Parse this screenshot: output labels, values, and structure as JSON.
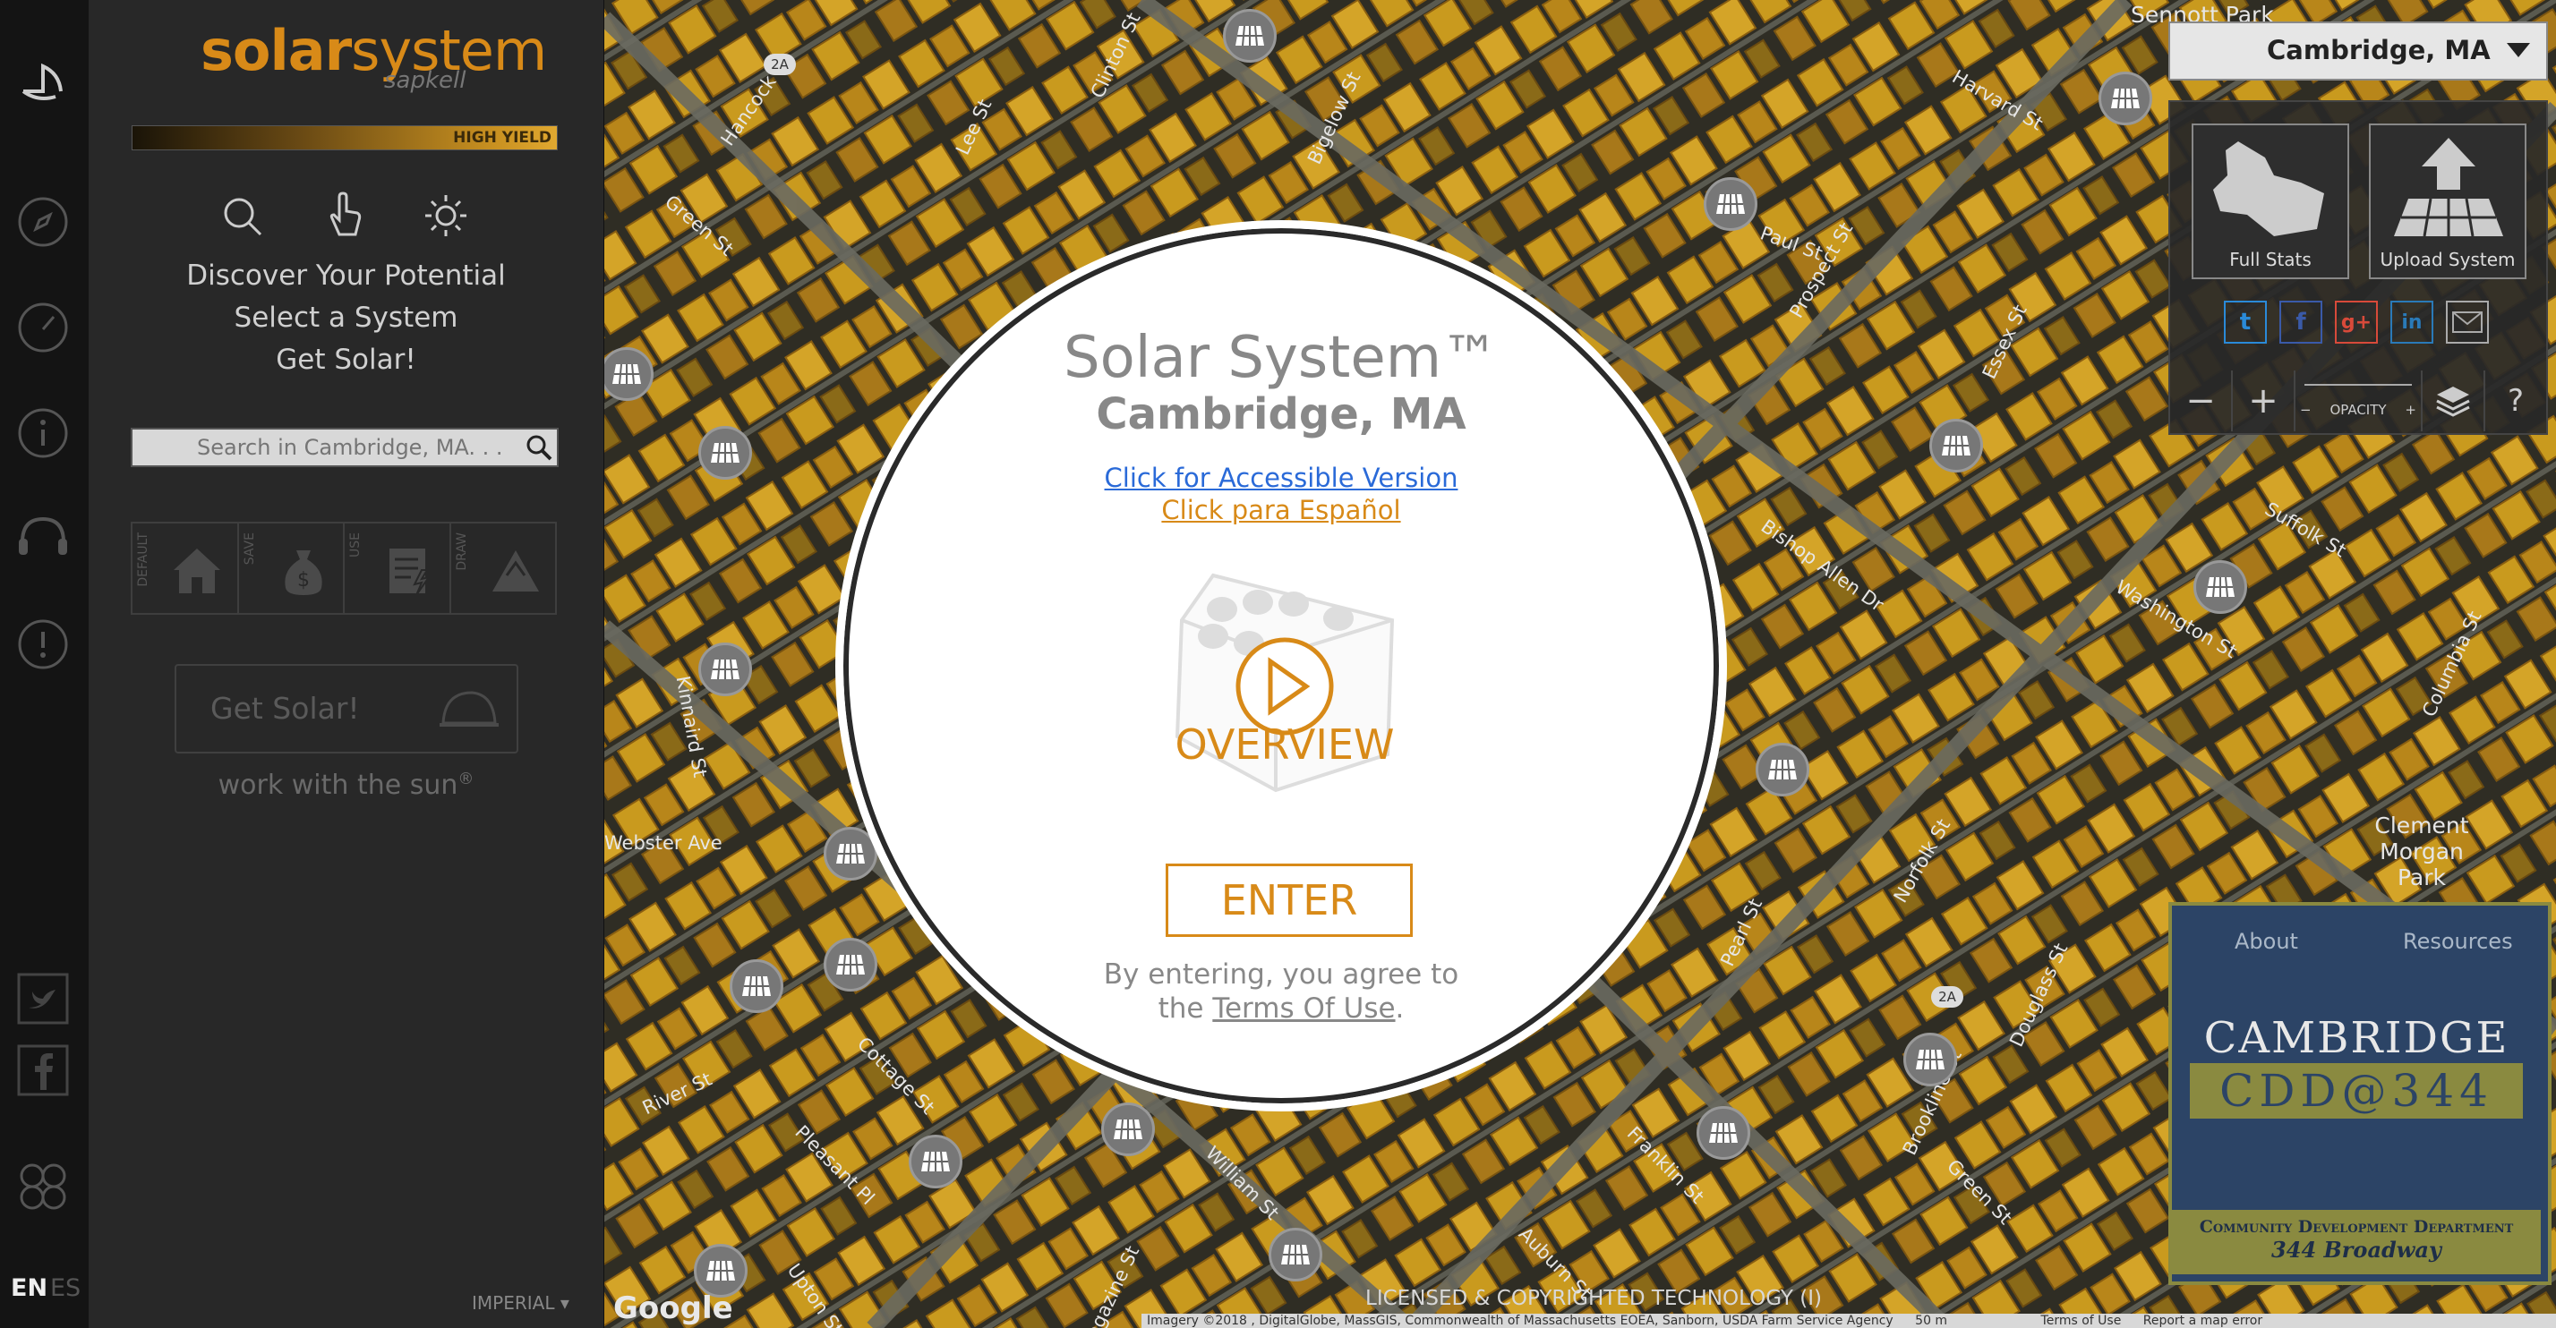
{
  "rail": {
    "icons": [
      "logo-icon",
      "compass-icon",
      "gauge-icon",
      "info-icon",
      "headset-icon",
      "alert-icon",
      "twitter-icon",
      "facebook-icon",
      "puzzle-icon"
    ],
    "lang_en": "EN",
    "lang_es": "ES"
  },
  "sidebar": {
    "logo_main": "solar",
    "logo_rest": "system",
    "logo_sub": "sapkell",
    "yield_label": "HIGH YIELD",
    "steps": [
      "Discover Your Potential",
      "Select a System",
      "Get Solar!"
    ],
    "search_placeholder": "Search in Cambridge, MA. . .",
    "modes": [
      "DEFAULT",
      "SAVE",
      "USE",
      "DRAW"
    ],
    "get_solar_label": "Get Solar!",
    "tagline": "work with the sun",
    "tagline_mark": "®",
    "units": "IMPERIAL"
  },
  "map": {
    "streets": [
      "Hancock St",
      "Green St",
      "Lee St",
      "Clinton St",
      "Bigelow St",
      "Harvard St",
      "Prospect St",
      "Paul St",
      "Essex St",
      "Suffolk St",
      "Washington St",
      "Columbia St",
      "Bishop Allen Dr",
      "Kinnaird St",
      "River St",
      "Cottage St",
      "Pleasant Pl",
      "William St",
      "Pearl St",
      "Franklin St",
      "Auburn St",
      "Green St",
      "Brookline St",
      "Norfolk St",
      "Douglass St",
      "Magazine St",
      "Upton St",
      "Webster Ave",
      "Clement Morgan Park",
      "Sennott Park"
    ],
    "route_badge": "2A",
    "google_label": "Google",
    "license_text": "LICENSED & COPYRIGHTED TECHNOLOGY (I)",
    "attribution": "Imagery ©2018 , DigitalGlobe, MassGIS, Commonwealth of Massachusetts EOEA, Sanborn, USDA Farm Service Agency",
    "scale": "50 m",
    "terms": "Terms of Use",
    "report": "Report a map error"
  },
  "modal": {
    "title": "Solar System™",
    "city": "Cambridge, MA",
    "accessible_link": "Click for Accessible Version",
    "spanish_link": "Click para Español",
    "overview_label": "OVERVIEW",
    "enter_label": "ENTER",
    "agree_text": "By entering, you agree to",
    "agree_the": "the",
    "terms_link": "Terms Of Use",
    "agree_end": "."
  },
  "right_panel": {
    "city_selected": "Cambridge, MA",
    "full_stats_label": "Full Stats",
    "upload_label": "Upload System",
    "social": [
      "twitter",
      "facebook",
      "google-plus",
      "linkedin",
      "email"
    ],
    "zoom_out": "−",
    "zoom_in": "+",
    "opacity_label": "OPACITY",
    "opacity_minus": "−",
    "opacity_plus": "+",
    "help": "?"
  },
  "cdd": {
    "about": "About",
    "resources": "Resources",
    "cambridge": "CAMBRIDGE",
    "cdd_tag": "CDD@344",
    "dept": "Community Development Department",
    "address": "344 Broadway"
  },
  "colors": {
    "accent": "#d88a18",
    "link_blue": "#2a6ad8",
    "sidebar_bg": "#282828",
    "rail_bg": "#141414",
    "cdd_bg": "#2c4466"
  }
}
